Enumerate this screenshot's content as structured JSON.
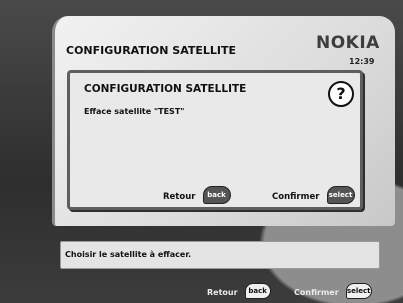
{
  "header": {
    "title": "CONFIGURATION SATELLITE",
    "brand": "NOKIA",
    "time": "12:39"
  },
  "dialog": {
    "title": "CONFIGURATION SATELLITE",
    "message": "Efface satellite \"TEST\"",
    "icon": "question-icon",
    "back_label": "Retour",
    "back_key": "back",
    "confirm_label": "Confirmer",
    "confirm_key": "select"
  },
  "status_bar": {
    "hint": "Choisir le satellite à effacer."
  },
  "footer": {
    "back_label": "Retour",
    "back_key": "back",
    "confirm_label": "Confirmer",
    "confirm_key": "select"
  }
}
